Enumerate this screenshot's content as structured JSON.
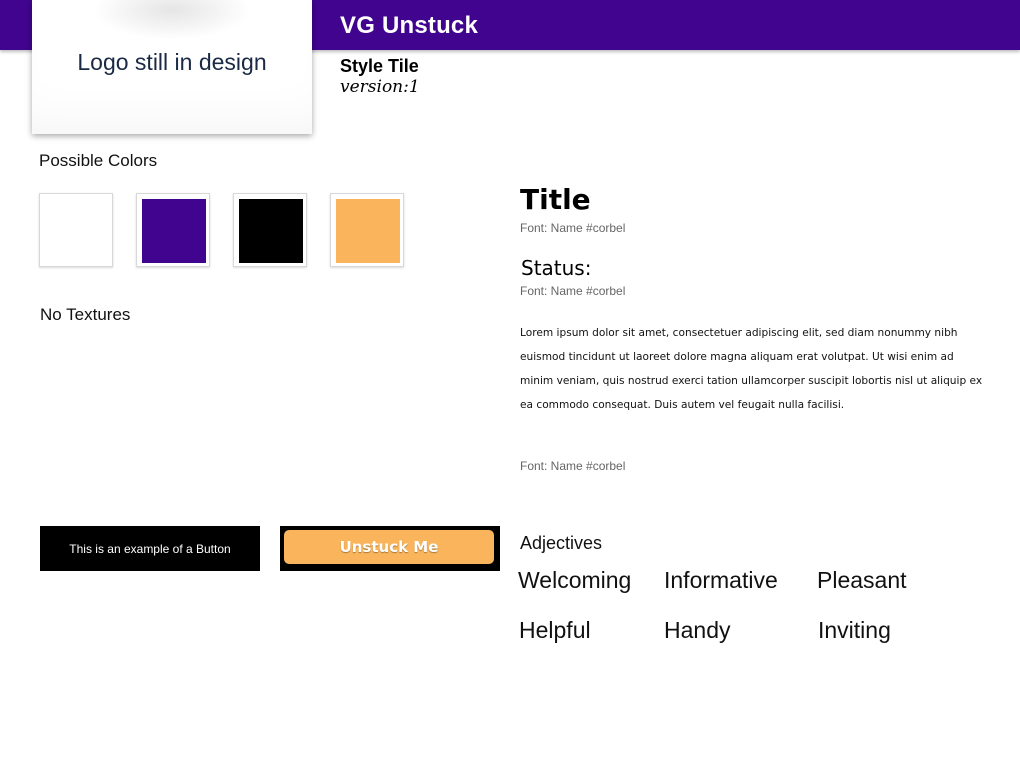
{
  "header": {
    "app_title": "VG Unstuck",
    "bar_color": "#40048f"
  },
  "logo": {
    "text": "Logo still in design"
  },
  "tile": {
    "label": "Style Tile",
    "version": "version:1"
  },
  "colors": {
    "label": "Possible Colors",
    "swatches": [
      "#ffffff",
      "#40048f",
      "#000000",
      "#fab55c"
    ]
  },
  "textures": {
    "label": "No Textures"
  },
  "typography": {
    "title_sample": "Title",
    "title_font_note": "Font: Name #corbel",
    "status_sample": "Status:",
    "status_font_note": "Font: Name #corbel",
    "body_sample": "Lorem ipsum dolor sit amet, consectetuer adipiscing elit, sed diam nonummy nibh euismod tincidunt ut laoreet dolore magna aliquam erat volutpat. Ut wisi enim ad minim veniam, quis nostrud exerci tation ullamcorper suscipit lobortis nisl ut aliquip ex ea commodo consequat. Duis autem vel feugait nulla facilisi.",
    "body_font_note": "Font: Name #corbel"
  },
  "buttons": {
    "example_label": "This is an example of a Button",
    "unstuck_label": "Unstuck Me"
  },
  "adjectives": {
    "label": "Adjectives",
    "items": [
      "Welcoming",
      "Informative",
      "Pleasant",
      "Helpful",
      "Handy",
      "Inviting"
    ]
  }
}
